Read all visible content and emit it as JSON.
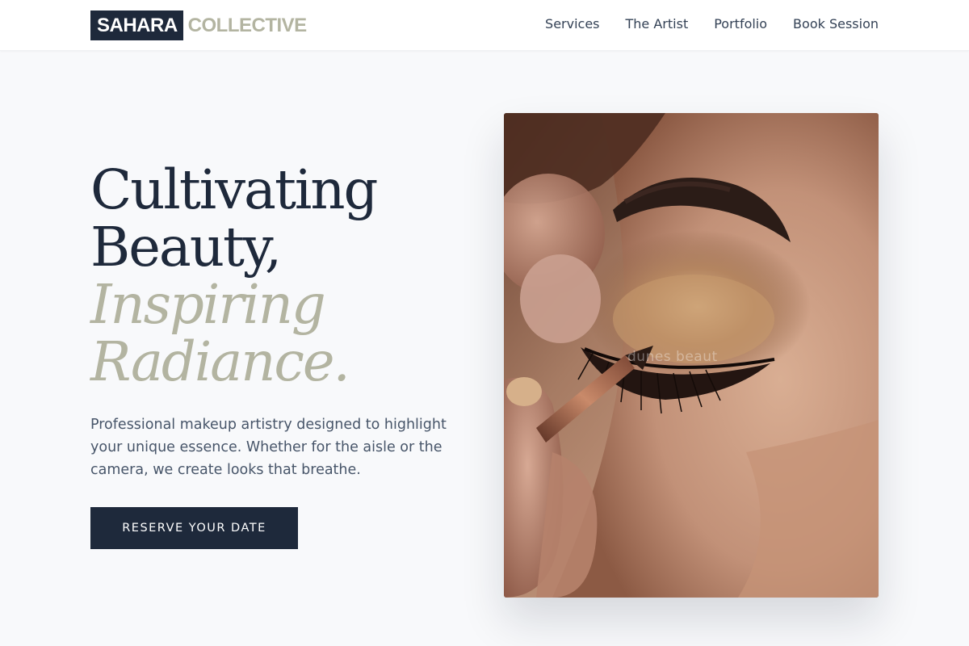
{
  "brand": {
    "name_boxed": "SAHARA",
    "name_rest": "COLLECTIVE"
  },
  "nav": {
    "items": [
      {
        "label": "Services"
      },
      {
        "label": "The Artist"
      },
      {
        "label": "Portfolio"
      },
      {
        "label": "Book Session"
      }
    ]
  },
  "hero": {
    "title_line1": "Cultivating",
    "title_line2": "Beauty,",
    "title_line3": "Inspiring",
    "title_line4": "Radiance.",
    "description": "Professional makeup artistry designed to highlight your unique essence. Whether for the aisle or the camera, we create looks that breathe.",
    "cta_label": "RESERVE YOUR DATE"
  },
  "image": {
    "watermark": "dunes beaut"
  },
  "colors": {
    "navy": "#1e293b",
    "sage": "#b3b4a1",
    "background": "#f8f9fb"
  }
}
